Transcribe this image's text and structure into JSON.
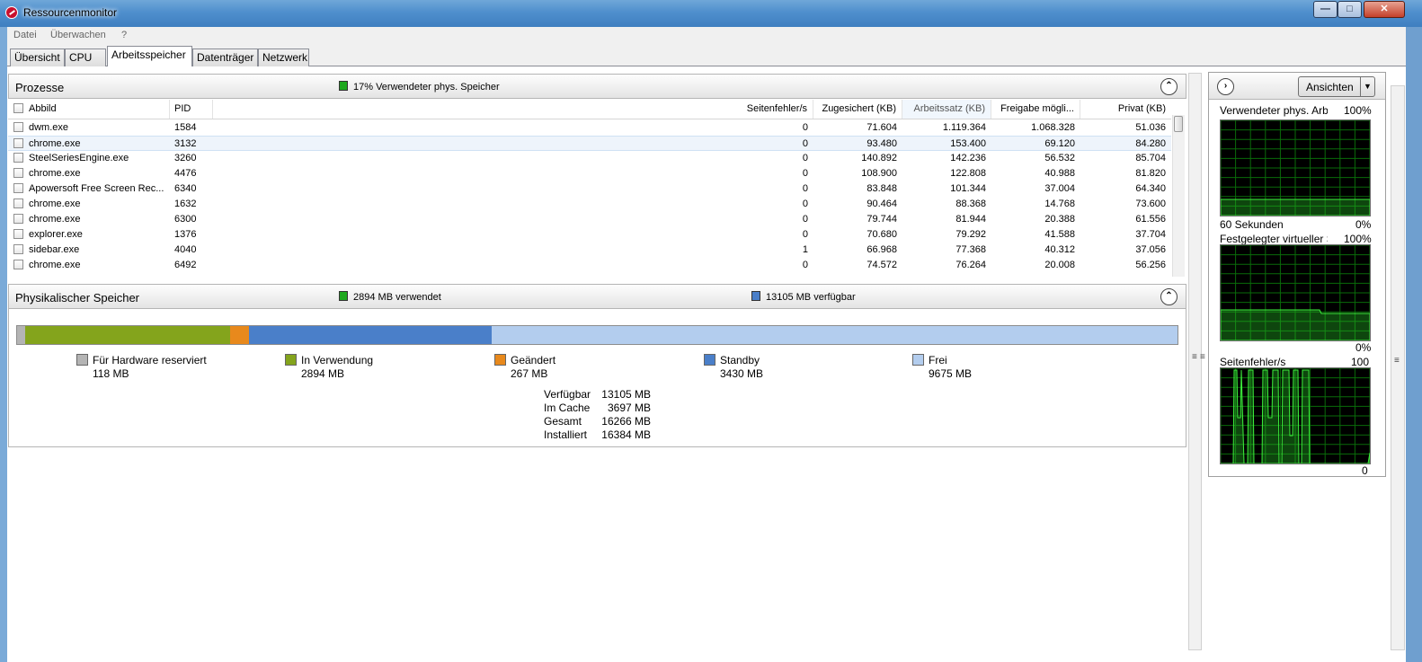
{
  "window": {
    "title": "Ressourcenmonitor",
    "min_glyph": "—",
    "max_glyph": "□",
    "close_glyph": "✕"
  },
  "menu": [
    "Datei",
    "Überwachen",
    "?"
  ],
  "tabs": [
    {
      "label": "Übersicht",
      "active": false
    },
    {
      "label": "CPU",
      "active": false
    },
    {
      "label": "Arbeitsspeicher",
      "active": true
    },
    {
      "label": "Datenträger",
      "active": false
    },
    {
      "label": "Netzwerk",
      "active": false
    }
  ],
  "processes": {
    "title": "Prozesse",
    "summary": "17% Verwendeter phys. Speicher",
    "summary_color": "#1ea81e",
    "collapse_glyph": "⌃",
    "columns": [
      "Abbild",
      "PID",
      "Seitenfehler/s",
      "Zugesichert (KB)",
      "Arbeitssatz (KB)",
      "Freigabe mögli...",
      "Privat (KB)"
    ],
    "rows": [
      [
        "dwm.exe",
        "1584",
        "0",
        "71.604",
        "1.119.364",
        "1.068.328",
        "51.036"
      ],
      [
        "chrome.exe",
        "3132",
        "0",
        "93.480",
        "153.400",
        "69.120",
        "84.280"
      ],
      [
        "SteelSeriesEngine.exe",
        "3260",
        "0",
        "140.892",
        "142.236",
        "56.532",
        "85.704"
      ],
      [
        "chrome.exe",
        "4476",
        "0",
        "108.900",
        "122.808",
        "40.988",
        "81.820"
      ],
      [
        "Apowersoft Free Screen Rec...",
        "6340",
        "0",
        "83.848",
        "101.344",
        "37.004",
        "64.340"
      ],
      [
        "chrome.exe",
        "1632",
        "0",
        "90.464",
        "88.368",
        "14.768",
        "73.600"
      ],
      [
        "chrome.exe",
        "6300",
        "0",
        "79.744",
        "81.944",
        "20.388",
        "61.556"
      ],
      [
        "explorer.exe",
        "1376",
        "0",
        "70.680",
        "79.292",
        "41.588",
        "37.704"
      ],
      [
        "sidebar.exe",
        "4040",
        "1",
        "66.968",
        "77.368",
        "40.312",
        "37.056"
      ],
      [
        "chrome.exe",
        "6492",
        "0",
        "74.572",
        "76.264",
        "20.008",
        "56.256"
      ]
    ]
  },
  "physical": {
    "title": "Physikalischer Speicher",
    "used_text": "2894 MB verwendet",
    "avail_text": "13105 MB verfügbar",
    "collapse_glyph": "⌃",
    "segments_mb": [
      118,
      2894,
      267,
      3430,
      9675
    ],
    "segment_colors": [
      "#b4b4b4",
      "#84a41c",
      "#e8891c",
      "#4a7fc9",
      "#b3cdee"
    ],
    "legend": [
      {
        "name": "Für Hardware reserviert",
        "value": "118 MB",
        "color": "#b4b4b4"
      },
      {
        "name": "In Verwendung",
        "value": "2894 MB",
        "color": "#84a41c"
      },
      {
        "name": "Geändert",
        "value": "267 MB",
        "color": "#e8891c"
      },
      {
        "name": "Standby",
        "value": "3430 MB",
        "color": "#4a7fc9"
      },
      {
        "name": "Frei",
        "value": "9675 MB",
        "color": "#b3cdee"
      }
    ],
    "summary": [
      {
        "label": "Verfügbar",
        "value": "13105 MB"
      },
      {
        "label": "Im Cache",
        "value": "3697 MB"
      },
      {
        "label": "Gesamt",
        "value": "16266 MB"
      },
      {
        "label": "Installiert",
        "value": "16384 MB"
      }
    ]
  },
  "right_pane": {
    "nav_glyph": "›",
    "views_label": "Ansichten",
    "views_dd": "▼",
    "graphs": [
      {
        "title": "Verwendeter phys. Arbe...",
        "max": "100%",
        "min_label": "60 Sekunden",
        "min": "0%"
      },
      {
        "title": "Festgelegter virtueller S...",
        "max": "100%",
        "min_label": "",
        "min": "0%"
      },
      {
        "title": "Seitenfehler/s",
        "max": "100",
        "min_label": "",
        "min": "0"
      }
    ]
  }
}
